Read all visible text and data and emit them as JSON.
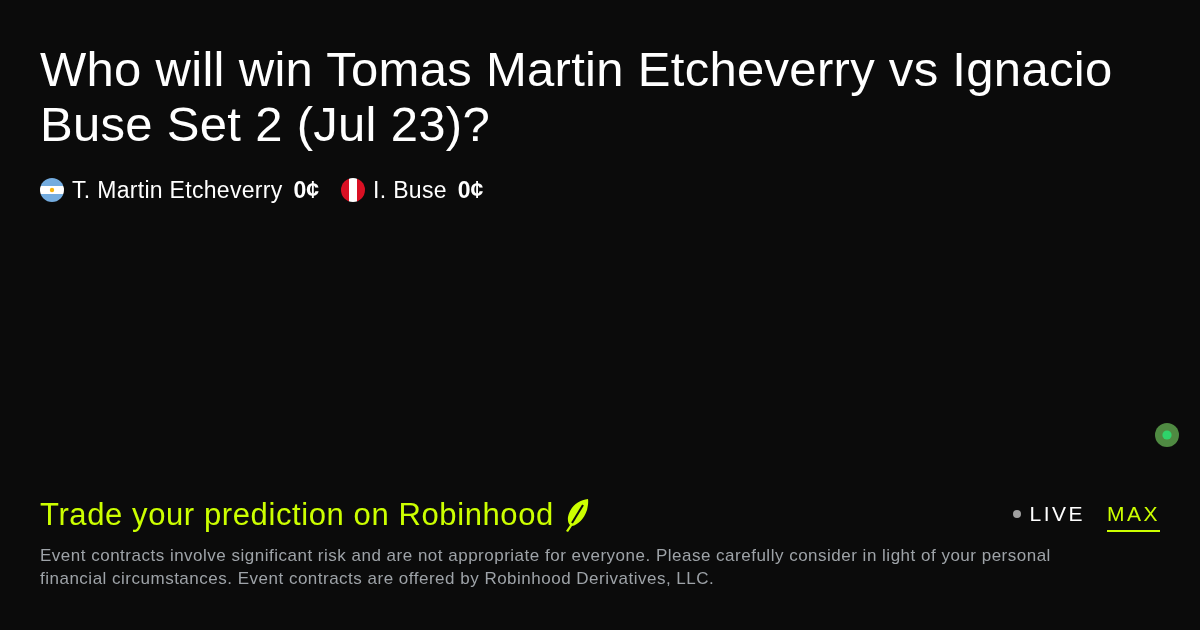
{
  "title": "Who will win Tomas Martin Etcheverry vs Ignacio Buse Set 2 (Jul 23)?",
  "outcomes": [
    {
      "kind": "argentina",
      "name": "T. Martin Etcheverry",
      "price": "0¢"
    },
    {
      "kind": "peru",
      "name": "I. Buse",
      "price": "0¢"
    }
  ],
  "footer": {
    "headline": "Trade your prediction on Robinhood",
    "tabs": [
      {
        "label": "LIVE",
        "kind": "live",
        "selected": false
      },
      {
        "label": "MAX",
        "kind": "range",
        "selected": true
      }
    ],
    "disclaimer": "Event contracts involve significant risk and are not appropriate for everyone. Please carefully consider in light of your personal financial circumstances. Event contracts are offered by Robinhood Derivatives, LLC."
  }
}
